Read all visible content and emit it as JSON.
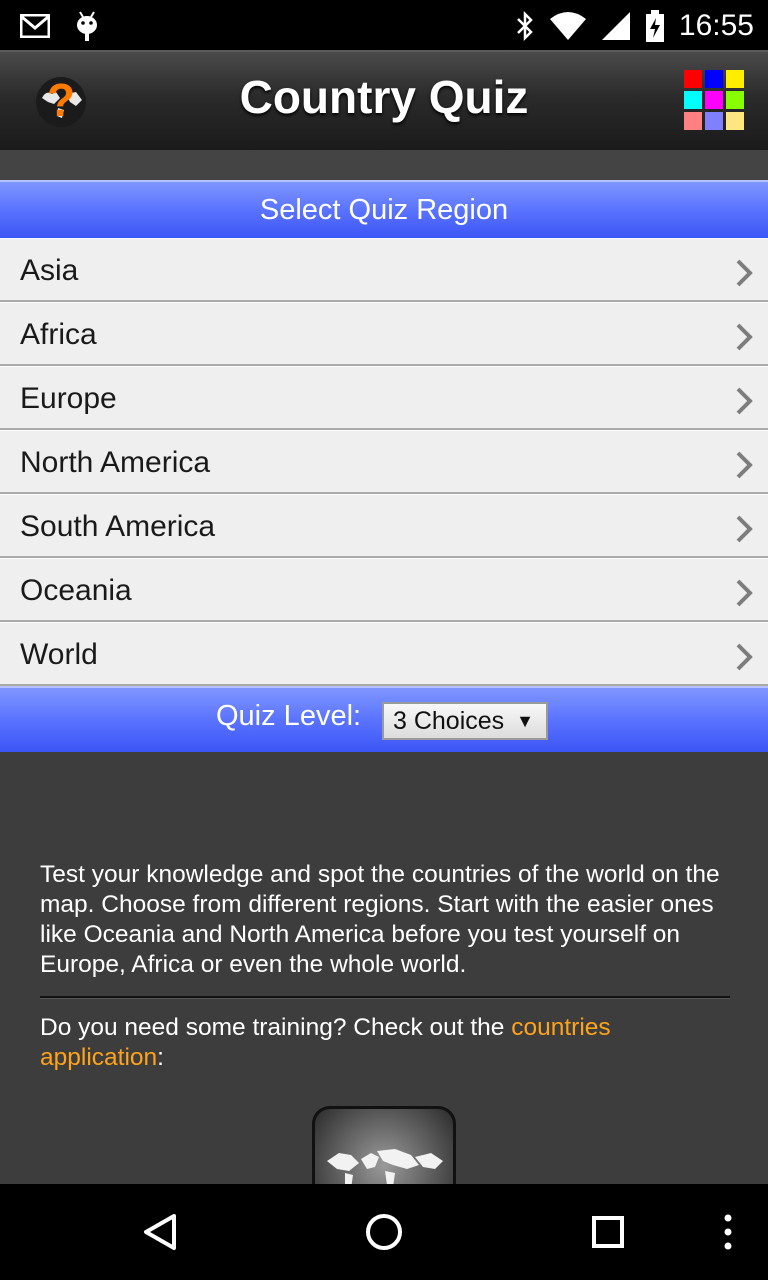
{
  "status_bar": {
    "time": "16:55",
    "icons": [
      "gmail-icon",
      "android-debug-icon",
      "bluetooth-icon",
      "wifi-icon",
      "cell-signal-icon",
      "battery-charging-icon"
    ]
  },
  "header": {
    "title": "Country Quiz",
    "logo_icon": "globe-question-icon",
    "apps_icon": "color-grid-icon",
    "grid_colors": [
      "#ff0000",
      "#0000ff",
      "#ffee00",
      "#00ffff",
      "#ff00ff",
      "#88ff00",
      "#ff8080",
      "#8080ff",
      "#ffe680"
    ]
  },
  "region_header": "Select Quiz Region",
  "regions": [
    {
      "label": "Asia"
    },
    {
      "label": "Africa"
    },
    {
      "label": "Europe"
    },
    {
      "label": "North America"
    },
    {
      "label": "South America"
    },
    {
      "label": "Oceania"
    },
    {
      "label": "World"
    }
  ],
  "quiz_level": {
    "label": "Quiz Level:",
    "selected": "3 Choices",
    "arrow": "▼"
  },
  "description": {
    "intro": "Test your knowledge and spot the countries of the world on the map. Choose from different regions. Start with the easier ones like Oceania and North America before you test yourself on Europe, Africa or even the whole world.",
    "training_prefix": "Do you need some training? Check out the ",
    "training_link": "countries application",
    "training_suffix": ":"
  },
  "promo_icon": "world-map-app-icon",
  "nav_bar": {
    "icons": [
      "back-icon",
      "home-icon",
      "recents-icon",
      "overflow-menu-icon"
    ]
  }
}
